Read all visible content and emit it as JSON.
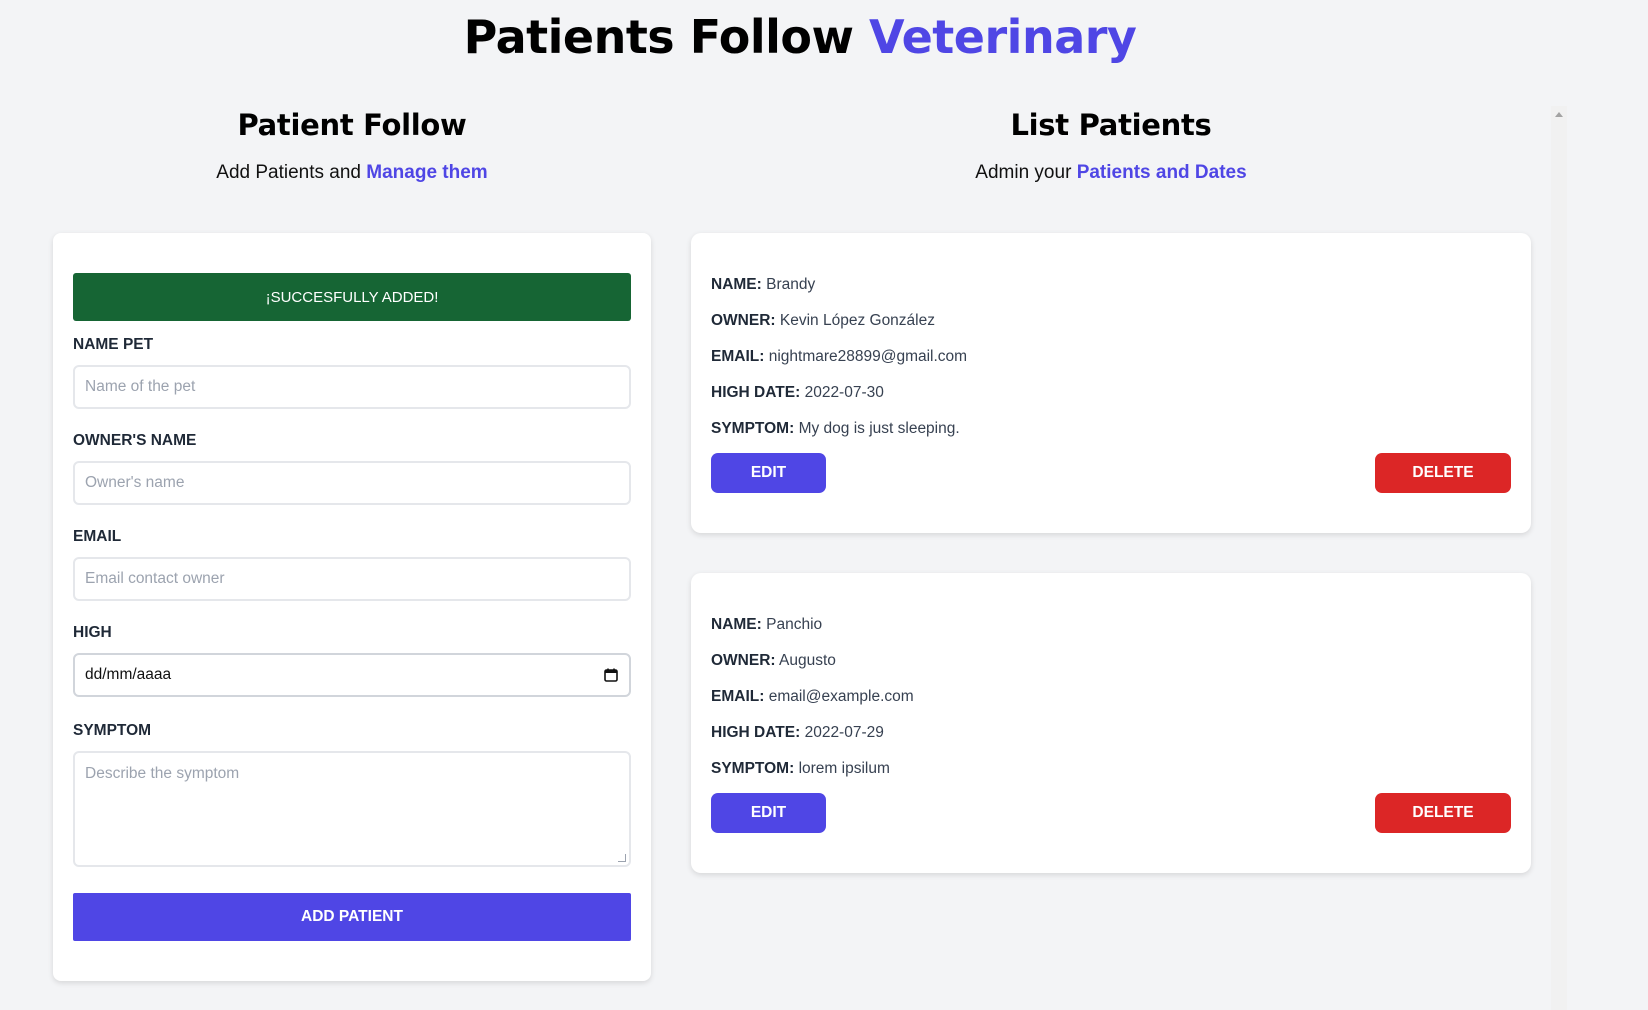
{
  "header": {
    "title_main": "Patients Follow",
    "title_accent": "Veterinary"
  },
  "form_section": {
    "heading": "Patient Follow",
    "subtitle_plain": "Add Patients and",
    "subtitle_accent": "Manage them",
    "alert": "¡SUCCESFULLY ADDED!",
    "fields": {
      "name_pet": {
        "label": "NAME PET",
        "placeholder": "Name of the pet"
      },
      "owner_name": {
        "label": "OWNER'S NAME",
        "placeholder": "Owner's name"
      },
      "email": {
        "label": "EMAIL",
        "placeholder": "Email contact owner"
      },
      "high": {
        "label": "HIGH",
        "value": "dd/mm/aaaa",
        "icon": "calendar-icon"
      },
      "symptom": {
        "label": "SYMPTOM",
        "placeholder": "Describe the symptom"
      }
    },
    "submit_label": "ADD PATIENT"
  },
  "list_section": {
    "heading": "List Patients",
    "subtitle_plain": "Admin your",
    "subtitle_accent": "Patients and Dates",
    "labels": {
      "name": "NAME:",
      "owner": "OWNER:",
      "email": "EMAIL:",
      "high_date": "HIGH DATE:",
      "symptom": "SYMPTOM:"
    },
    "patients": [
      {
        "name": "Brandy",
        "owner": "Kevin López González",
        "email": "nightmare28899@gmail.com",
        "high_date": "2022-07-30",
        "symptom": "My dog is just sleeping.",
        "edit_label": "EDIT",
        "delete_label": "DELETE"
      },
      {
        "name": "Panchio",
        "owner": "Augusto",
        "email": "email@example.com",
        "high_date": "2022-07-29",
        "symptom": "lorem ipsilum",
        "edit_label": "EDIT",
        "delete_label": "DELETE"
      }
    ]
  },
  "colors": {
    "accent": "#4f46e5",
    "success": "#166534",
    "danger": "#dc2626",
    "background": "#f3f4f6"
  }
}
